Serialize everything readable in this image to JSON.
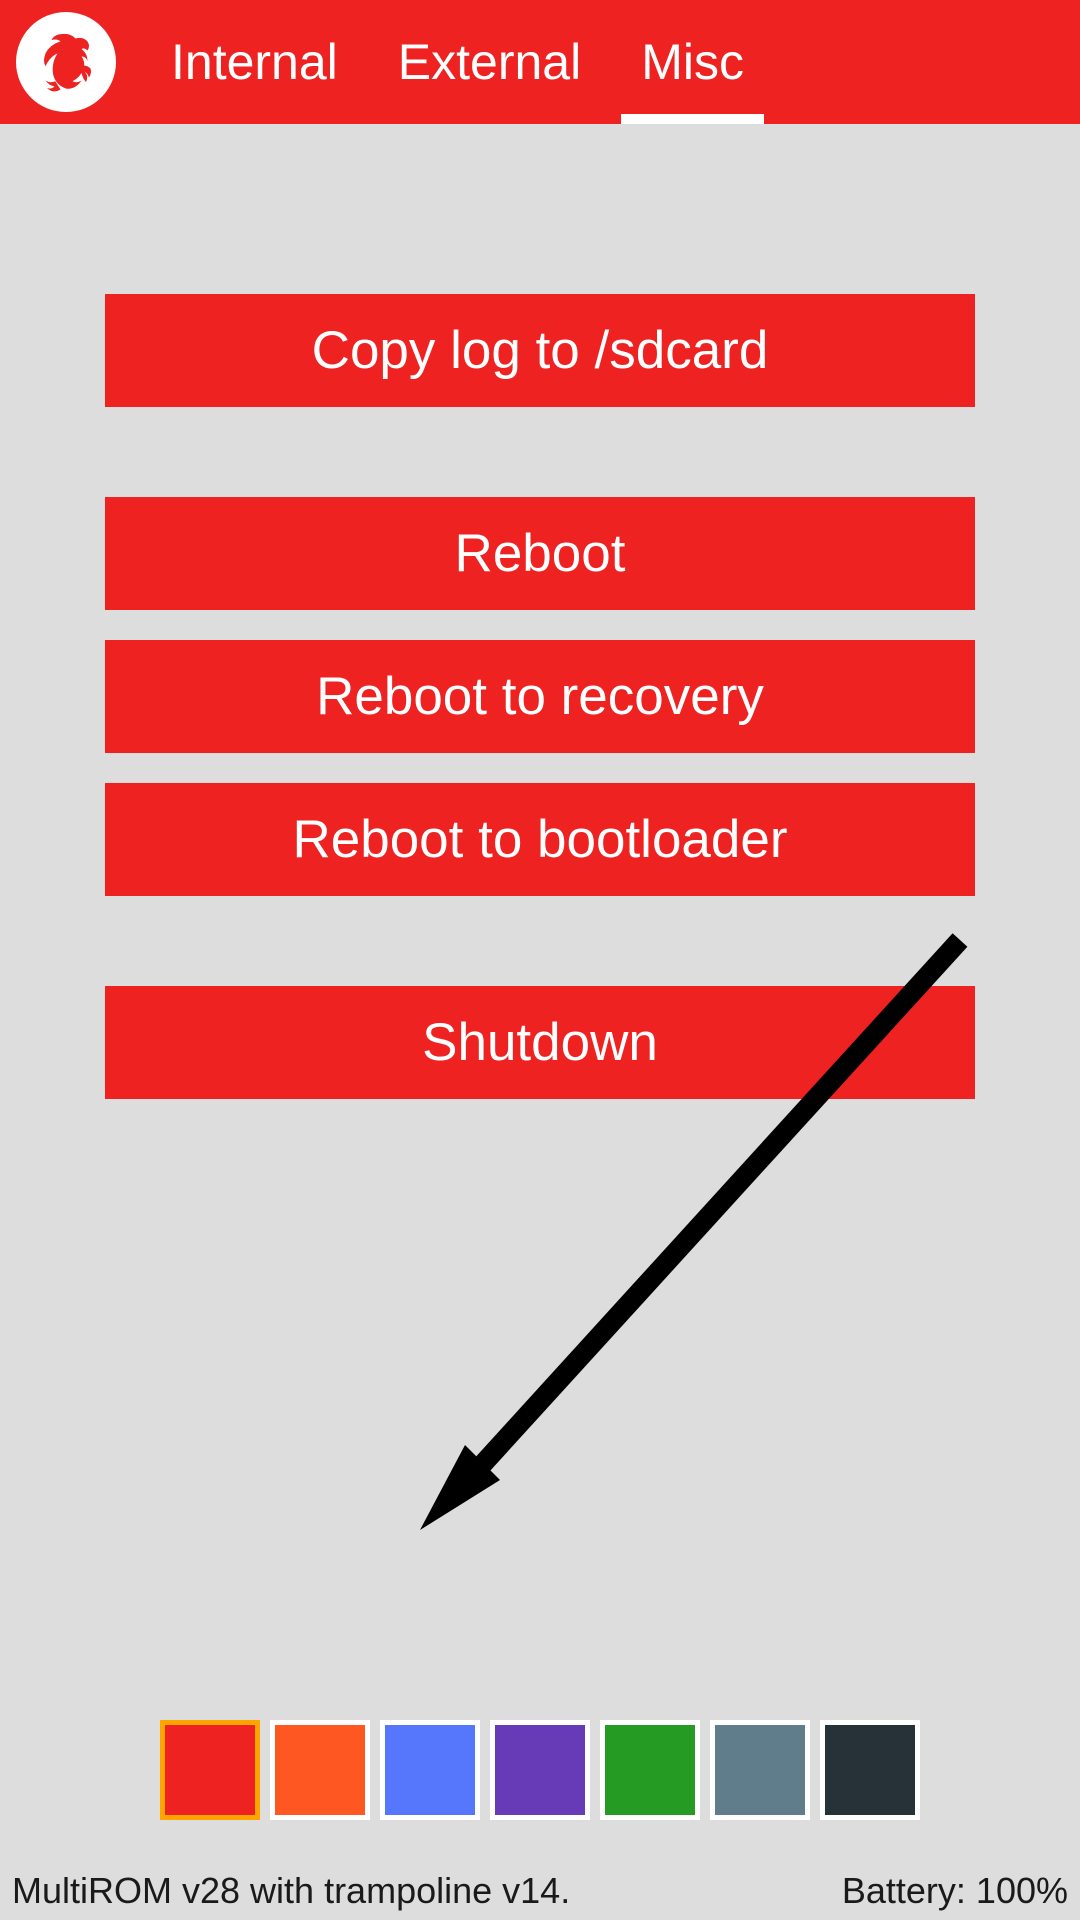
{
  "header": {
    "tabs": [
      {
        "label": "Internal",
        "active": false
      },
      {
        "label": "External",
        "active": false
      },
      {
        "label": "Misc",
        "active": true
      }
    ]
  },
  "buttons": {
    "copy_log": "Copy log to /sdcard",
    "reboot": "Reboot",
    "reboot_recovery": "Reboot to recovery",
    "reboot_bootloader": "Reboot to bootloader",
    "shutdown": "Shutdown"
  },
  "colors": [
    {
      "hex": "#ef2222",
      "active": true
    },
    {
      "hex": "#ff5722",
      "active": false
    },
    {
      "hex": "#5677fc",
      "active": false
    },
    {
      "hex": "#673ab7",
      "active": false
    },
    {
      "hex": "#259b24",
      "active": false
    },
    {
      "hex": "#607d8b",
      "active": false
    },
    {
      "hex": "#263238",
      "active": false
    }
  ],
  "footer": {
    "version": "MultiROM v28 with trampoline v14.",
    "battery": "Battery: 100%"
  }
}
